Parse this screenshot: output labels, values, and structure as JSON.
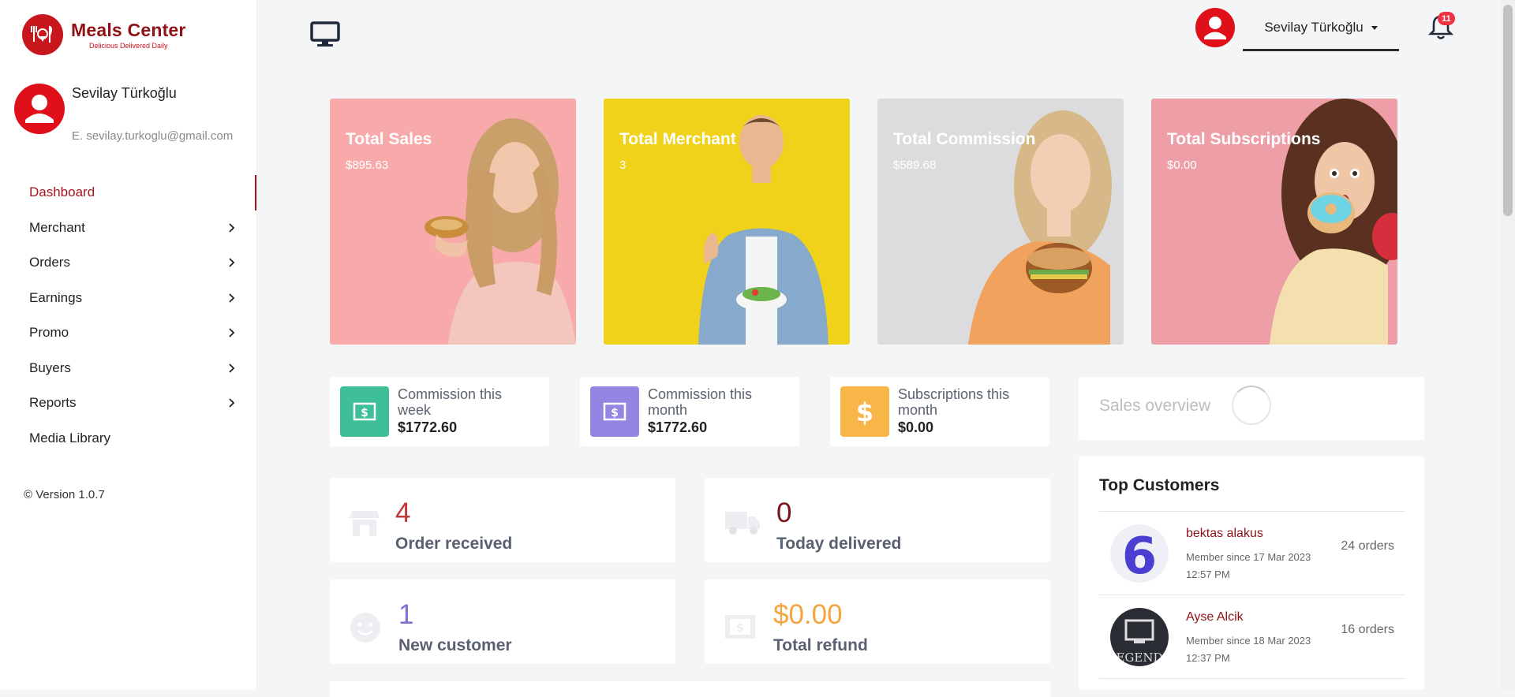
{
  "brand": {
    "name": "Meals Center",
    "tagline": "Delicious Delivered Daily",
    "color": "#a5141b"
  },
  "profile": {
    "name": "Sevilay Türkoğlu",
    "email": "E. sevilay.turkoglu@gmail.com"
  },
  "sidebar": {
    "items": [
      {
        "label": "Dashboard",
        "active": true
      },
      {
        "label": "Merchant",
        "has_submenu": true
      },
      {
        "label": "Orders",
        "has_submenu": true
      },
      {
        "label": "Earnings",
        "has_submenu": true
      },
      {
        "label": "Promo",
        "has_submenu": true
      },
      {
        "label": "Buyers",
        "has_submenu": true
      },
      {
        "label": "Reports",
        "has_submenu": true
      },
      {
        "label": "Media Library"
      }
    ],
    "version": "© Version 1.0.7"
  },
  "header": {
    "user_name": "Sevilay Türkoğlu",
    "notification_count": "11",
    "icons": [
      "monitor-icon",
      "avatar-icon",
      "bell-icon"
    ]
  },
  "hero_cards": [
    {
      "title": "Total Sales",
      "value": "$895.63",
      "bg": "#f8a9a9"
    },
    {
      "title": "Total Merchant",
      "value": "3",
      "bg": "#f1d21a"
    },
    {
      "title": "Total Commission",
      "value": "$589.68",
      "bg": "#dcdcdf"
    },
    {
      "title": "Total Subscriptions",
      "value": "$0.00",
      "bg": "#ee9ea6"
    }
  ],
  "mini_stats": [
    {
      "label": "Commission this week",
      "value": "$1772.60",
      "color": "#3fbf97",
      "icon": "money-icon"
    },
    {
      "label": "Commission this month",
      "value": "$1772.60",
      "color": "#9585e2",
      "icon": "money-icon"
    },
    {
      "label": "Subscriptions this month",
      "value": "$0.00",
      "color": "#f8b548",
      "icon": "dollar-icon"
    }
  ],
  "sales_overview": {
    "label": "Sales overview"
  },
  "metrics": [
    {
      "number": "4",
      "label": "Order received",
      "color": "#c23838",
      "icon": "store-icon"
    },
    {
      "number": "0",
      "label": "Today delivered",
      "color": "#7a1517",
      "icon": "truck-icon"
    },
    {
      "number": "1",
      "label": "New customer",
      "color": "#7d6fd6",
      "icon": "smile-icon"
    },
    {
      "number": "$0.00",
      "label": "Total refund",
      "color": "#f5a53d",
      "icon": "money-icon"
    }
  ],
  "top_customers": {
    "title": "Top Customers",
    "rows": [
      {
        "name": "bektas alakus",
        "since": "Member since 17 Mar 2023 12:57 PM",
        "orders": "24 orders"
      },
      {
        "name": "Ayse Alcik",
        "since": "Member since 18 Mar 2023 12:37 PM",
        "orders": "16 orders"
      }
    ]
  }
}
